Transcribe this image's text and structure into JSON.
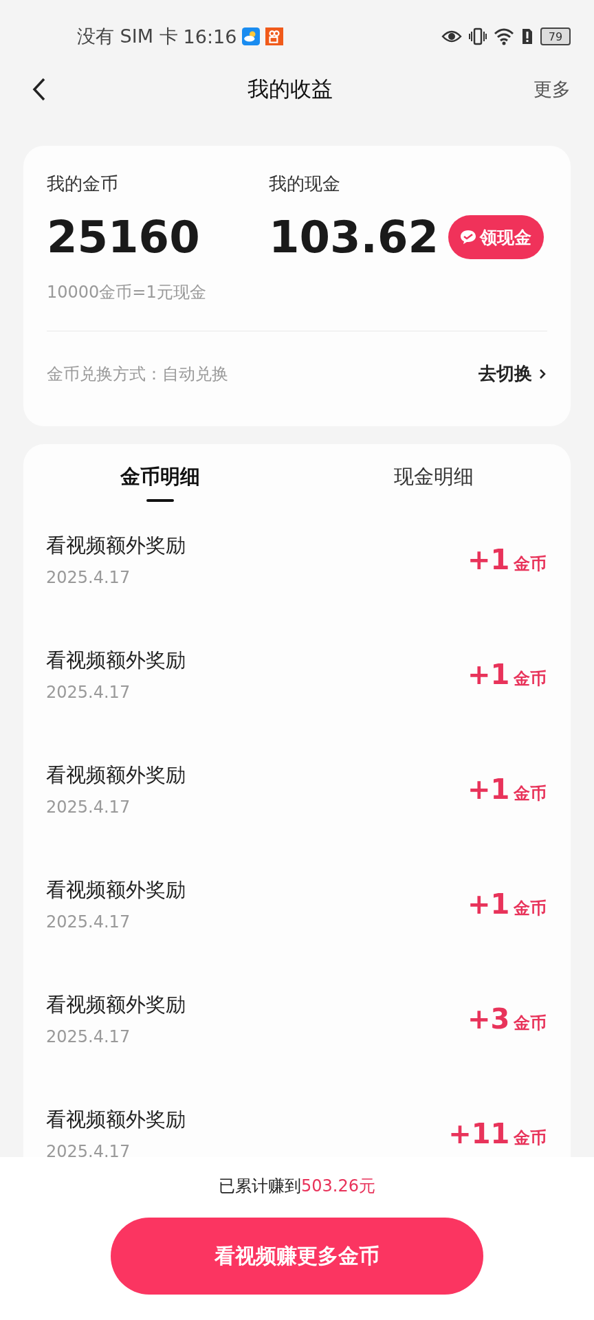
{
  "status_bar": {
    "carrier": "没有 SIM 卡",
    "time": "16:16",
    "battery": "79"
  },
  "nav": {
    "title": "我的收益",
    "action": "更多"
  },
  "summary": {
    "coins_label": "我的金币",
    "coins_value": "25160",
    "cash_label": "我的现金",
    "cash_value": "103.62",
    "withdraw_button": "领现金",
    "rate_note": "10000金币=1元现金",
    "exchange_label": "金币兑换方式：自动兑换",
    "switch_link": "去切换"
  },
  "tabs": [
    {
      "label": "金币明细",
      "selected": true
    },
    {
      "label": "现金明细",
      "selected": false
    }
  ],
  "records": [
    {
      "title": "看视频额外奖励",
      "date": "2025.4.17",
      "amount": "+1",
      "unit": "金币"
    },
    {
      "title": "看视频额外奖励",
      "date": "2025.4.17",
      "amount": "+1",
      "unit": "金币"
    },
    {
      "title": "看视频额外奖励",
      "date": "2025.4.17",
      "amount": "+1",
      "unit": "金币"
    },
    {
      "title": "看视频额外奖励",
      "date": "2025.4.17",
      "amount": "+1",
      "unit": "金币"
    },
    {
      "title": "看视频额外奖励",
      "date": "2025.4.17",
      "amount": "+3",
      "unit": "金币"
    },
    {
      "title": "看视频额外奖励",
      "date": "2025.4.17",
      "amount": "+11",
      "unit": "金币"
    }
  ],
  "footer": {
    "total_prefix": "已累计赚到",
    "total_amount": "503.26元",
    "button": "看视频赚更多金币"
  }
}
